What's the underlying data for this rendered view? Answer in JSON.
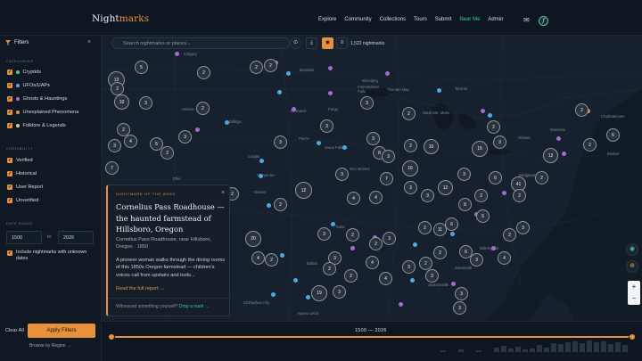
{
  "nav": {
    "logo_main": "Night",
    "logo_accent": "marks",
    "links": [
      "Explore",
      "Community",
      "Collections",
      "Tours",
      "Submit",
      "Near Me",
      "Admin"
    ],
    "active_link": "Near Me",
    "mail_icon": "mail-icon",
    "avatar_letter": "f"
  },
  "sidebar": {
    "title": "Filters",
    "filter_icon": "filter-icon",
    "categories_heading": "CATEGORIES",
    "categories": [
      {
        "label": "Cryptids",
        "color": "#3fc7a6"
      },
      {
        "label": "UFOs/UAPs",
        "color": "#4ea8e6"
      },
      {
        "label": "Ghosts & Hauntings",
        "color": "#a46ad6"
      },
      {
        "label": "Unexplained Phenomena",
        "color": "#e8913a"
      },
      {
        "label": "Folklore & Legends",
        "color": "#d9c48a"
      }
    ],
    "credibility_heading": "CREDIBILITY",
    "credibility": [
      "Verified",
      "Historical",
      "User Report",
      "Unverified"
    ],
    "date_heading": "DATE RANGE",
    "date_from": "1500",
    "date_to_label": "to",
    "date_to": "2026",
    "include_unknown": "Include nightmarks with unknown dates",
    "clear_all": "Clear All",
    "apply": "Apply Filters",
    "browse": "Browse by Region →"
  },
  "map": {
    "search_placeholder": "Search nightmarks or places...",
    "count_label": "1,522 nightmarks",
    "places": [
      {
        "name": "Calgary"
      },
      {
        "name": "Brandon"
      },
      {
        "name": "Winnipeg"
      },
      {
        "name": "Thunder Bay"
      },
      {
        "name": "International Falls"
      },
      {
        "name": "Toronto"
      },
      {
        "name": "Helena"
      },
      {
        "name": "Billings"
      },
      {
        "name": "Bismarck"
      },
      {
        "name": "Fargo"
      },
      {
        "name": "Sault Ste. Marie"
      },
      {
        "name": "Ottawa"
      },
      {
        "name": "Montreal"
      },
      {
        "name": "Charlottetown"
      },
      {
        "name": "Casper"
      },
      {
        "name": "Pierre"
      },
      {
        "name": "Sioux Falls"
      },
      {
        "name": "Des Moines"
      },
      {
        "name": "Cheyenne"
      },
      {
        "name": "Denver"
      },
      {
        "name": "Elko"
      },
      {
        "name": "Boston"
      },
      {
        "name": "Bridgeport"
      },
      {
        "name": "Tulsa"
      },
      {
        "name": "Wilmington"
      },
      {
        "name": "Savannah"
      },
      {
        "name": "Jacksonville"
      },
      {
        "name": "Dallas"
      },
      {
        "name": "Chihuahua City"
      },
      {
        "name": "Nuevo León"
      }
    ],
    "clusters": [
      {
        "n": "5"
      },
      {
        "n": "2"
      },
      {
        "n": "2"
      },
      {
        "n": "2"
      },
      {
        "n": "13"
      },
      {
        "n": "10"
      },
      {
        "n": "3"
      },
      {
        "n": "2"
      },
      {
        "n": "2"
      },
      {
        "n": "3"
      },
      {
        "n": "2"
      },
      {
        "n": "3"
      },
      {
        "n": "5"
      },
      {
        "n": "2"
      },
      {
        "n": "3"
      },
      {
        "n": "3"
      },
      {
        "n": "4"
      },
      {
        "n": "3"
      },
      {
        "n": "7"
      },
      {
        "n": "3"
      },
      {
        "n": "2"
      },
      {
        "n": "8"
      },
      {
        "n": "2"
      },
      {
        "n": "10"
      },
      {
        "n": "15"
      },
      {
        "n": "2"
      },
      {
        "n": "3"
      },
      {
        "n": "12"
      },
      {
        "n": "2"
      },
      {
        "n": "16"
      },
      {
        "n": "7"
      },
      {
        "n": "6"
      },
      {
        "n": "3"
      },
      {
        "n": "3"
      },
      {
        "n": "4"
      },
      {
        "n": "12"
      },
      {
        "n": "2"
      },
      {
        "n": "2"
      },
      {
        "n": "4"
      },
      {
        "n": "3"
      },
      {
        "n": "3"
      },
      {
        "n": "12"
      },
      {
        "n": "6"
      },
      {
        "n": "41"
      },
      {
        "n": "2"
      },
      {
        "n": "2"
      },
      {
        "n": "3"
      },
      {
        "n": "8"
      },
      {
        "n": "6"
      },
      {
        "n": "2"
      },
      {
        "n": "11"
      },
      {
        "n": "5"
      },
      {
        "n": "2"
      },
      {
        "n": "3"
      },
      {
        "n": "20"
      },
      {
        "n": "4"
      },
      {
        "n": "2"
      },
      {
        "n": "3"
      },
      {
        "n": "2"
      },
      {
        "n": "3"
      },
      {
        "n": "2"
      },
      {
        "n": "3"
      },
      {
        "n": "2"
      },
      {
        "n": "2"
      },
      {
        "n": "4"
      },
      {
        "n": "19"
      },
      {
        "n": "3"
      },
      {
        "n": "3"
      },
      {
        "n": "2"
      },
      {
        "n": "3"
      },
      {
        "n": "2"
      },
      {
        "n": "3"
      },
      {
        "n": "3"
      },
      {
        "n": "6"
      },
      {
        "n": "4"
      },
      {
        "n": "3"
      },
      {
        "n": "5"
      },
      {
        "n": "2"
      },
      {
        "n": "2"
      },
      {
        "n": "2"
      },
      {
        "n": "4"
      },
      {
        "n": "3"
      }
    ]
  },
  "card": {
    "eyebrow": "NIGHTMARE OF THE WEEK",
    "title": "Cornelius Pass Roadhouse — the haunted farmstead of Hillsboro, Oregon",
    "subtitle": "Cornelius Pass Roadhouse, near Hillsboro, Oregon · 1850",
    "description": "A pioneer woman walks through the dining rooms of this 1850s Oregon farmstead — children's voices call from upstairs and tools...",
    "link": "Read the full report →",
    "foot_prefix": "Witnessed something yourself?",
    "foot_link": "Drop a mark →"
  },
  "timeline": {
    "label": "1500 — 2026",
    "range_start": 1500,
    "range_end": 2026
  },
  "colors": {
    "accent": "#e8913a",
    "teal": "#3fc7a6",
    "ufo": "#4ea8e6",
    "ghost": "#a46ad6"
  }
}
